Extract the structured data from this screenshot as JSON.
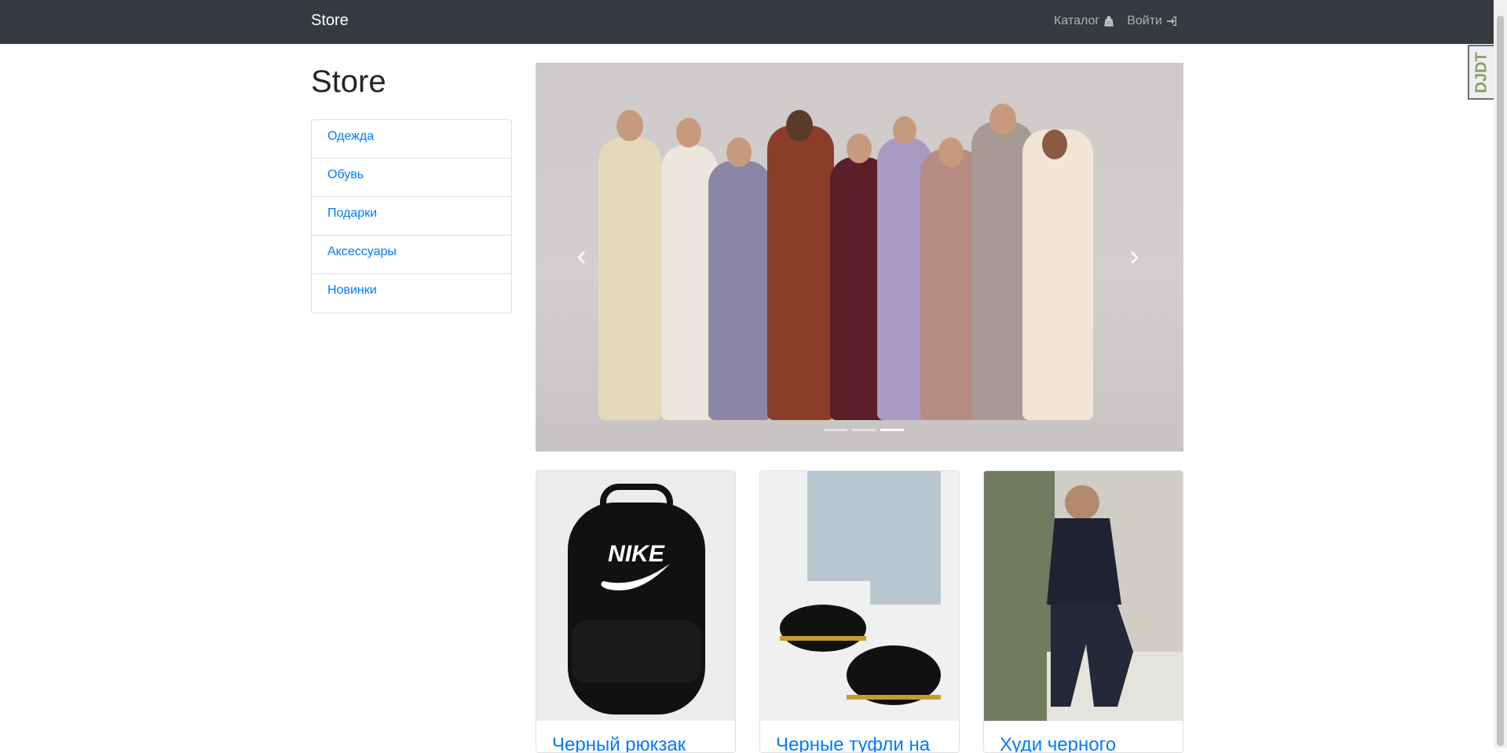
{
  "navbar": {
    "brand": "Store",
    "links": [
      {
        "label": "Каталог",
        "icon": "shopping-bag-icon"
      },
      {
        "label": "Войти",
        "icon": "sign-in-icon"
      }
    ]
  },
  "page": {
    "title": "Store"
  },
  "categories": [
    "Одежда",
    "Обувь",
    "Подарки",
    "Аксессуары",
    "Новинки"
  ],
  "carousel": {
    "indicators": 3,
    "active": 3
  },
  "cards": [
    {
      "title": "Черный рюкзак"
    },
    {
      "title": "Черные туфли на"
    },
    {
      "title": "Худи черного"
    }
  ],
  "debug_toolbar": {
    "label": "DJDT"
  }
}
